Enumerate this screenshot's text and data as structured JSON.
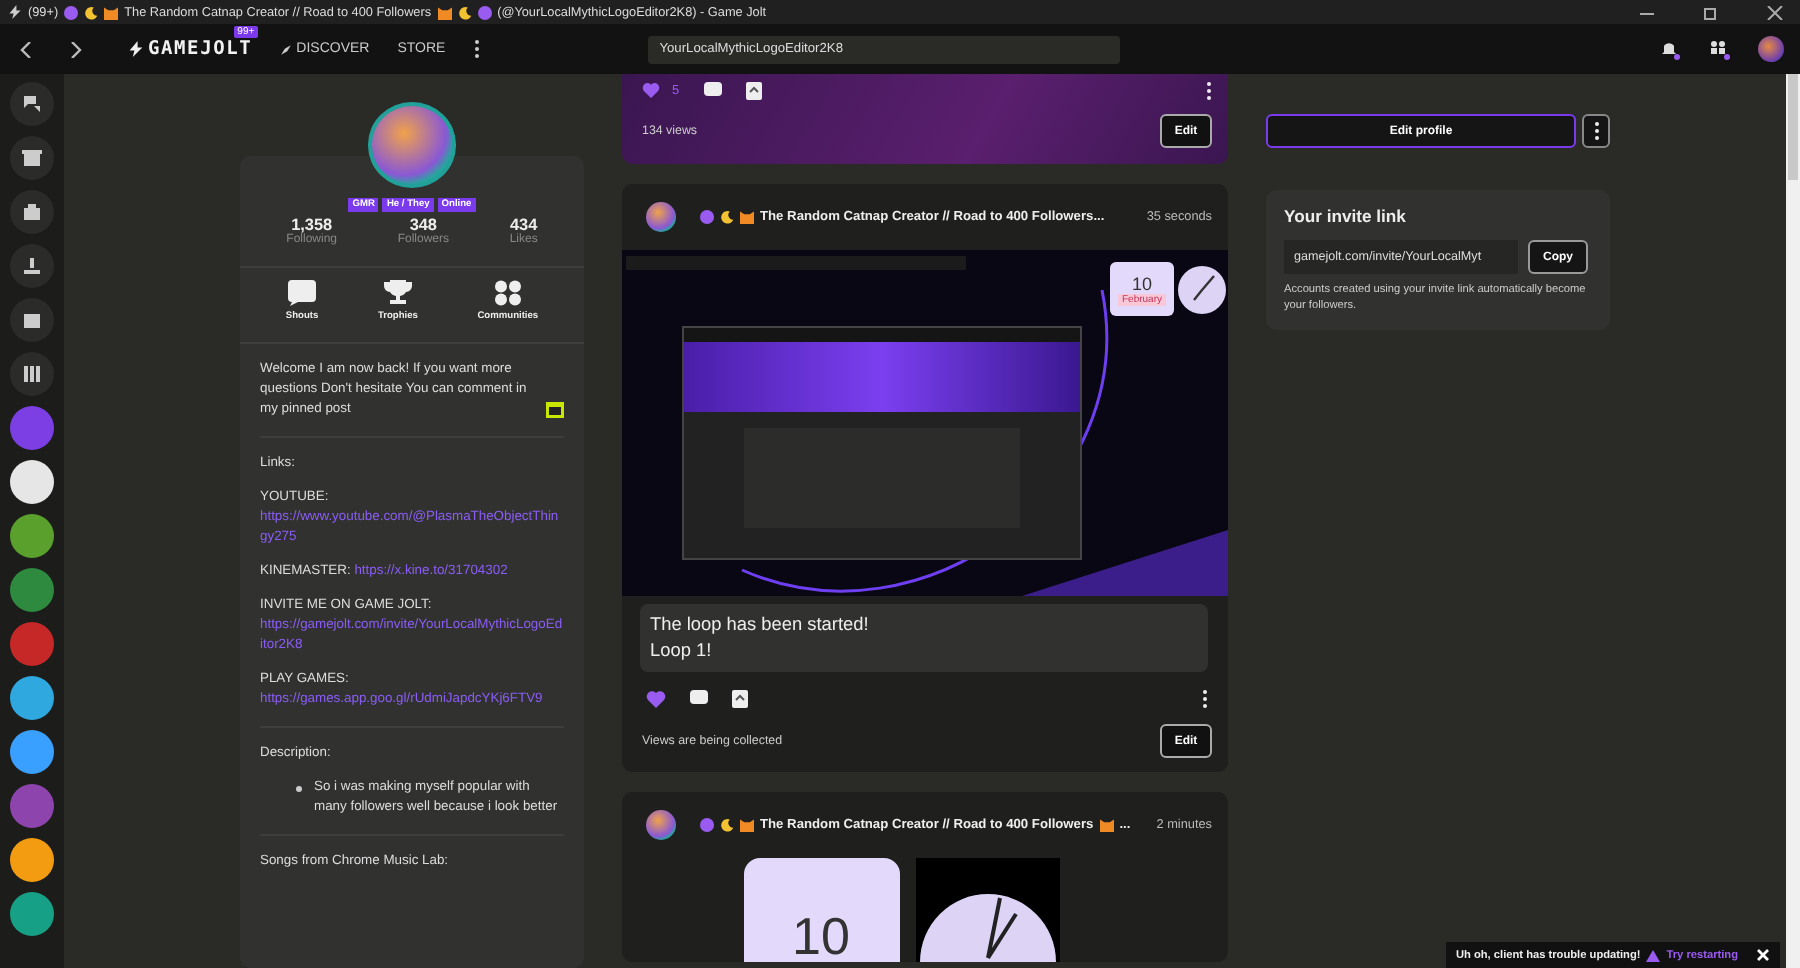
{
  "title_bar": {
    "count": "(99+)",
    "name": "The Random Catnap Creator // Road to 400 Followers",
    "handle": "(@YourLocalMythicLogoEditor2K8) - Game Jolt"
  },
  "nav": {
    "logo": "GAMEJOLT",
    "badge": "99+",
    "links": [
      {
        "kind": "discover",
        "label": "DISCOVER"
      },
      {
        "kind": "store",
        "label": "STORE"
      }
    ],
    "search": {
      "value": "YourLocalMythicLogoEditor2K8"
    }
  },
  "profile": {
    "tags": [
      "GMR",
      "He / They",
      "Online"
    ],
    "stats": [
      {
        "value": "1,358",
        "label": "Following"
      },
      {
        "value": "348",
        "label": "Followers"
      },
      {
        "value": "434",
        "label": "Likes"
      }
    ],
    "actions": [
      {
        "kind": "shouts",
        "label": "Shouts"
      },
      {
        "kind": "trophies",
        "label": "Trophies"
      },
      {
        "kind": "communities",
        "label": "Communities"
      }
    ],
    "bio": "Welcome I am now back! If you want more questions Don't hesitate You can comment in my pinned post",
    "links_heading": "Links:",
    "links": [
      {
        "label": "YOUTUBE:",
        "url": "https://www.youtube.com/@PlasmaTheObjectThingy275",
        "inline": false
      },
      {
        "label": "KINEMASTER:",
        "url": "https://x.kine.to/31704302",
        "inline": true
      },
      {
        "label": "INVITE ME ON GAME JOLT:",
        "url": "https://gamejolt.com/invite/YourLocalMythicLogoEditor2K8",
        "inline": false
      },
      {
        "label": "PLAY GAMES:",
        "url": "https://games.app.goo.gl/rUdmiJapdcYKj6FTV9",
        "inline": false
      }
    ],
    "description_heading": "Description:",
    "description_items": [
      "So i was making myself popular with many followers well because i look better"
    ],
    "songs_heading": "Songs from Chrome Music Lab:"
  },
  "pinned_post": {
    "liked": true,
    "likes": "5",
    "views": "134 views",
    "edit": "Edit"
  },
  "posts": [
    {
      "title": "The Random Catnap Creator // Road to 400 Followers...",
      "time": "35 seconds",
      "image": {
        "kind": "desktop",
        "day": "10",
        "month": "February"
      },
      "text_lines": [
        "The loop has been started!",
        "Loop 1!"
      ],
      "liked": true,
      "views": "Views are being collected",
      "edit": "Edit"
    },
    {
      "title": "The Random Catnap Creator // Road to 400 Followers",
      "after_icon": "...",
      "time": "2 minutes",
      "image": {
        "kind": "widgets",
        "day": "10"
      }
    }
  ],
  "sidebar_panel": {
    "edit_profile": "Edit profile",
    "invite": {
      "title": "Your invite link",
      "value": "gamejolt.com/invite/YourLocalMyt",
      "copy": "Copy",
      "note": "Accounts created using your invite link automatically become your followers."
    }
  },
  "toast": {
    "message": "Uh oh, client has trouble updating!",
    "action": "Try restarting"
  }
}
